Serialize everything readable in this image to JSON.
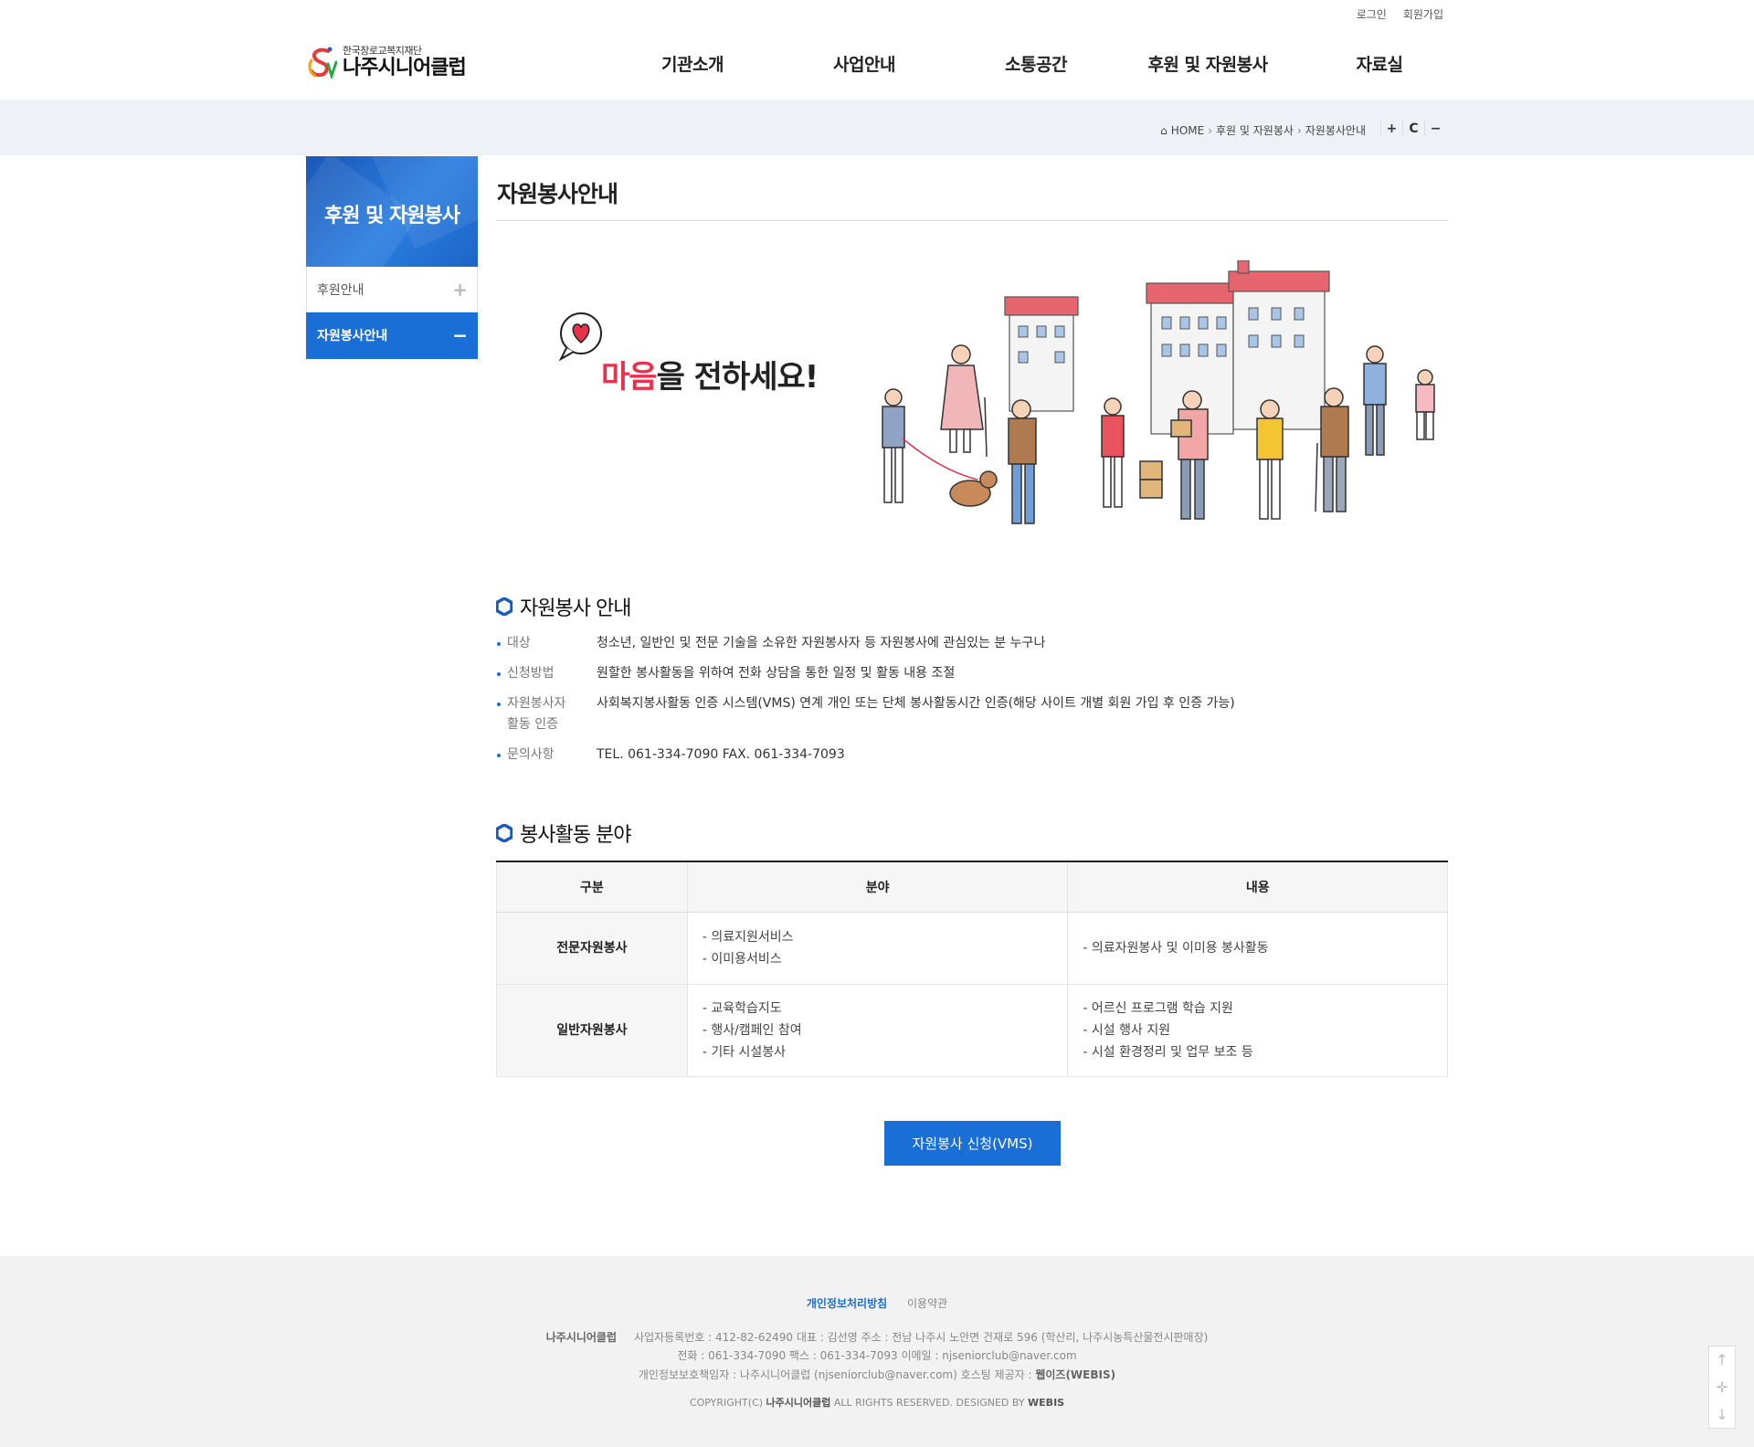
{
  "util": {
    "login": "로그인",
    "join": "회원가입"
  },
  "logo": {
    "sub": "한국장로교복지재단",
    "main": "나주시니어클럽"
  },
  "gnb": [
    "기관소개",
    "사업안내",
    "소통공간",
    "후원 및 자원봉사",
    "자료실"
  ],
  "breadcrumb": {
    "home": "HOME",
    "level1": "후원 및 자원봉사",
    "level2": "자원봉사안내"
  },
  "zoom": {
    "in": "+",
    "reset": "C",
    "out": "−"
  },
  "lnb": {
    "title": "후원 및 자원봉사",
    "items": [
      {
        "label": "후원안내",
        "sign": "+"
      },
      {
        "label": "자원봉사안내",
        "sign": "−"
      }
    ]
  },
  "content": {
    "title": "자원봉사안내",
    "hero_text_a": "마음",
    "hero_text_b": "을 전하세요!",
    "section1": "자원봉사 안내",
    "info": [
      {
        "k": "대상",
        "v": "청소년, 일반인 및 전문 기술을 소유한 자원봉사자 등 자원봉사에 관심있는 분 누구나"
      },
      {
        "k": "신청방법",
        "v": "원할한 봉사활동을 위하여 전화 상담을 통한 일정 및 활동 내용 조절"
      },
      {
        "k": "자원봉사자 활동 인증",
        "v": "사회복지봉사활동 인증 시스템(VMS) 연계 개인 또는 단체 봉사활동시간 인증(해당 사이트 개별 회원 가입 후 인증 가능)"
      },
      {
        "k": "문의사항",
        "v": "TEL. 061-334-7090 FAX. 061-334-7093"
      }
    ],
    "section2": "봉사활동 분야",
    "table": {
      "headers": [
        "구분",
        "분야",
        "내용"
      ],
      "rows": [
        {
          "cat": "전문자원봉사",
          "field": [
            "- 의료지원서비스",
            "- 이미용서비스"
          ],
          "desc": [
            "- 의료자원봉사 및 이미용 봉사활동"
          ]
        },
        {
          "cat": "일반자원봉사",
          "field": [
            "- 교육학습지도",
            "- 행사/캠페인 참여",
            "- 기타 시설봉사"
          ],
          "desc": [
            "- 어르신 프로그램 학습 지원",
            "- 시설 행사 지원",
            "- 시설 환경정리 및 업무 보조 등"
          ]
        }
      ]
    },
    "button": "자원봉사 신청(VMS)"
  },
  "footer": {
    "privacy": "개인정보처리방침",
    "terms": "이용약관",
    "line1_name": "나주시니어클럽",
    "line1": "사업자등록번호 : 412-82-62490   대표 : 김선영   주소 : 전남 나주시 노안면 건재로 596 (학산리, 나주시농특산물전시판매장)",
    "line2": "전화 : 061-334-7090   팩스 : 061-334-7093   이메일 : njseniorclub@naver.com",
    "line3_a": "개인정보보호책임자 : 나주시니어클럽 (njseniorclub@naver.com)   호스팅 제공자 : ",
    "line3_b": "웹이즈(WEBIS)",
    "copy_a": "COPYRIGHT(C) ",
    "copy_b": "나주시니어클럽",
    "copy_c": " ALL RIGHTS RESERVED. DESIGNED BY ",
    "copy_d": "WEBIS"
  },
  "quick": {
    "up": "↑",
    "mid": "✛",
    "down": "↓"
  },
  "colors": {
    "accent": "#1a6fd6",
    "hero_red": "#e8324c"
  }
}
